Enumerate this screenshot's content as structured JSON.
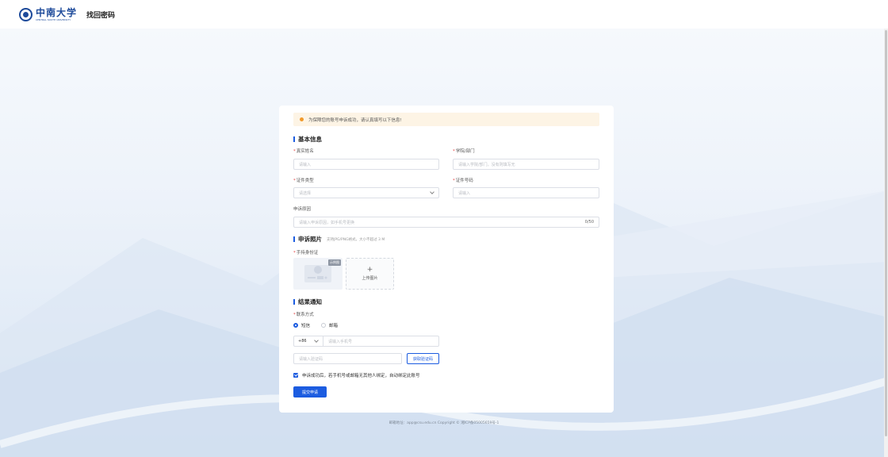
{
  "header": {
    "logo_cn": "中南大学",
    "logo_en": "CENTRAL SOUTH UNIVERSITY",
    "title": "找回密码"
  },
  "notice": "为保障您的账号申诉成功，请认真填写以下信息!",
  "basic_info": {
    "section_title": "基本信息",
    "real_name": {
      "label": "真实姓名",
      "placeholder": "请输入"
    },
    "college": {
      "label": "学院/部门",
      "placeholder": "请输入学院/部门，没有则填写无"
    },
    "id_type": {
      "label": "证件类型",
      "placeholder": "请选择"
    },
    "id_number": {
      "label": "证件号码",
      "placeholder": "请输入"
    },
    "reason": {
      "label": "申诉原因",
      "placeholder": "请输入申诉原因，如手机号更换",
      "counter": "0/50"
    }
  },
  "photo": {
    "section_title": "申诉照片",
    "hint": "支持JPG/PNG格式，大小不超过 3 M",
    "field_label": "手持身份证",
    "sample_badge": "示例图",
    "upload_label": "上传图片",
    "upload_plus": "+"
  },
  "notify": {
    "section_title": "结果通知",
    "contact_label": "联系方式",
    "options": [
      "短信",
      "邮箱"
    ],
    "selected": "短信",
    "country_code": "+86",
    "phone_placeholder": "请输入手机号",
    "code_placeholder": "请输入验证码",
    "get_code_label": "获取验证码",
    "agree_text": "申诉成功后，若手机号或邮箱无其他人绑定，自动绑定此账号",
    "agree_checked": true,
    "submit_label": "提交申请"
  },
  "footer": "邮箱地址：app@csu.edu.cn Copyright © 湘ICP备05005659号-1",
  "colors": {
    "primary": "#1c5ce0",
    "notice_bg": "#fdf4e5",
    "notice_icon": "#f19a2b",
    "brand": "#1d4a9a"
  }
}
